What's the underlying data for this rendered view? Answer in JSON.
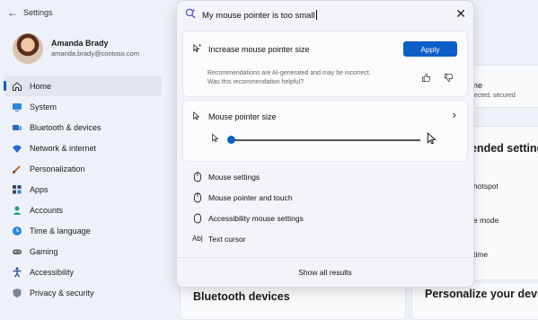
{
  "window": {
    "back_glyph": "←",
    "title": "Settings"
  },
  "profile": {
    "name": "Amanda Brady",
    "email": "amanda.brady@contoso.com"
  },
  "sidebar": {
    "items": [
      {
        "label": "Home"
      },
      {
        "label": "System"
      },
      {
        "label": "Bluetooth & devices"
      },
      {
        "label": "Network & internet"
      },
      {
        "label": "Personalization"
      },
      {
        "label": "Apps"
      },
      {
        "label": "Accounts"
      },
      {
        "label": "Time & language"
      },
      {
        "label": "Gaming"
      },
      {
        "label": "Accessibility"
      },
      {
        "label": "Privacy & security"
      }
    ]
  },
  "main": {
    "card1": {
      "title_fragment": "me",
      "sub_fragment": "nected, secured"
    },
    "recommended_fragment": "ended setting",
    "rows": [
      "hotspot",
      "e mode",
      "time"
    ],
    "bluetooth_heading": "Bluetooth devices",
    "personalize_heading": "Personalize your devic"
  },
  "search": {
    "query": "My mouse pointer is too small",
    "close_glyph": "✕"
  },
  "recommendation": {
    "title": "Increase mouse pointer size",
    "apply_label": "Apply",
    "disclaimer": "Recommendations are AI-generated and may be incorrect. Was this recommendation helpful?"
  },
  "pointer_size": {
    "title": "Mouse pointer size",
    "chevron": "›",
    "slider_level": 0
  },
  "results": [
    {
      "label": "Mouse settings",
      "icon": "mouse-icon"
    },
    {
      "label": "Mouse pointer and touch",
      "icon": "mouse-icon"
    },
    {
      "label": "Accessibility mouse settings",
      "icon": "mouse-icon"
    },
    {
      "label": "Text cursor",
      "icon": "text-cursor-icon"
    }
  ],
  "show_all_label": "Show all results",
  "colors": {
    "accent": "#0b5fc7"
  }
}
